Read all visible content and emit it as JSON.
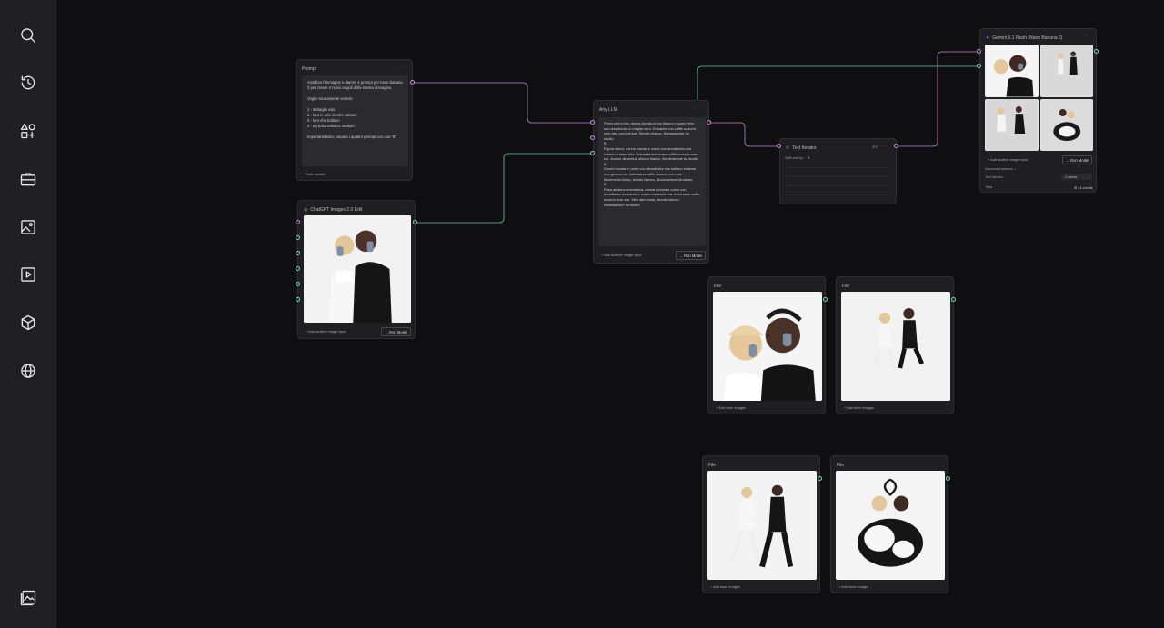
{
  "sidebar": {
    "items": [
      {
        "icon": "search-icon"
      },
      {
        "icon": "history-icon"
      },
      {
        "icon": "shapes-plus-icon"
      },
      {
        "icon": "toolbox-icon"
      },
      {
        "icon": "image-icon"
      },
      {
        "icon": "video-icon"
      },
      {
        "icon": "cube-icon"
      },
      {
        "icon": "globe-icon"
      },
      {
        "icon": "gallery-icon"
      }
    ]
  },
  "colors": {
    "background": "#0f0f12",
    "node": "#1f1f23",
    "panel": "#2a2a2f",
    "port_text": "#c58ad8",
    "port_image": "#7fd3b8"
  },
  "prompt_node": {
    "title": "Prompt",
    "menu": "···",
    "text": "Analizza l'immagine e dammi 4 prompt per nano banana 2 per creare 4 nuovi angoli della stessa immagine.\n\nVoglio sicuramente vedere:\n\n1 - dettaglio viso\n2 - loro in aria mentre saltano\n3 - loro che ballano\n4 - un posa artistica random\n\nImportantissimo, separa i quattro prompt con una \"$\"",
    "add_variable": "+ Add variable"
  },
  "chatgpt_node": {
    "title": "ChatGPT Images 2.0 Edit",
    "menu": "···",
    "add_input": "+ Add another image input",
    "run": "→ Run Model"
  },
  "llm_node": {
    "title": "Any LLM",
    "menu": "···",
    "text": "Primo piano visi, donna bionda in top bianco e uomo nero con dreadlocks in maglia nera. Entrambi con cuffie azzurre over-ear, occhi chiusi. Sfondo bianco, illuminazione da studio.\n$\nFigura intera, donna bionda e uomo con dreadlocks che saltano a mezz'aria. Entrambi indossano cuffie azzurre over-ear. Azione dinamica, sfondo bianco, illuminazione da studio.\n$\nDonna bionda e uomo con dreadlocks che ballano insieme energicamente. Indossano cuffie azzurre over-ear. Movimento fluido, sfondo bianco, illuminazione da studio.\n$\nPosa artistica simmetrica, donna bionda e uomo con dreadlocks incastrati in una forma scultorea. Indossano cuffie azzurre over-ear. Stile alta moda, sfondo bianco, illuminazione da studio.",
    "add_input": "+ Add another image input",
    "run": "→ Run Model"
  },
  "iterator_node": {
    "title": "Text Iterator",
    "count": "4/4",
    "menu": "···",
    "split_label": "Split text by:",
    "split_value": "$"
  },
  "gemini_node": {
    "title": "Gemini 3.1 Flash (Nano Banana 2)",
    "menu": "···",
    "add_input": "+ Add another image input",
    "run": "→ Run Model",
    "advanced": "Advanced params ⌄",
    "text_iterator_label": "Text Iterator",
    "text_iterator_value": "4 values",
    "total_label": "Total",
    "total_value": "✲ 24 credits"
  },
  "file_nodes": [
    {
      "title": "File",
      "add": "+ Add more images"
    },
    {
      "title": "File",
      "add": "+ Add more images"
    },
    {
      "title": "File",
      "add": "+ Add more images"
    },
    {
      "title": "File",
      "add": "+ Add more images"
    }
  ]
}
